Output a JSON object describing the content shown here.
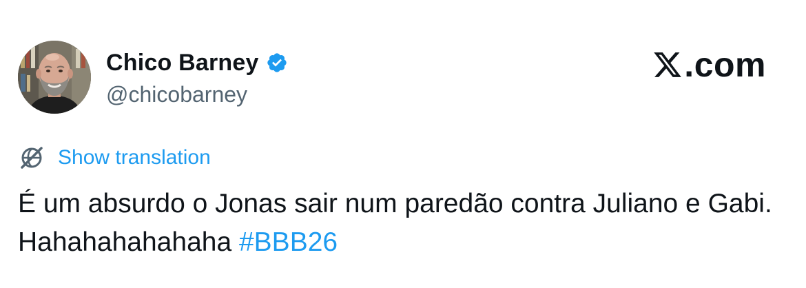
{
  "author": {
    "display_name": "Chico Barney",
    "handle": "@chicobarney",
    "verified": true,
    "verified_color": "#1d9bf0"
  },
  "brand": {
    "text": ".com",
    "icon": "x-logo-icon"
  },
  "translation": {
    "label": "Show translation",
    "icon": "globe-translate-icon"
  },
  "tweet": {
    "text": "É um absurdo o Jonas sair num paredão contra Juliano e Gabi. Hahahahahahaha ",
    "hashtag": "#BBB26"
  },
  "colors": {
    "text": "#0f1419",
    "secondary": "#536471",
    "accent": "#1d9bf0",
    "background": "#ffffff"
  }
}
